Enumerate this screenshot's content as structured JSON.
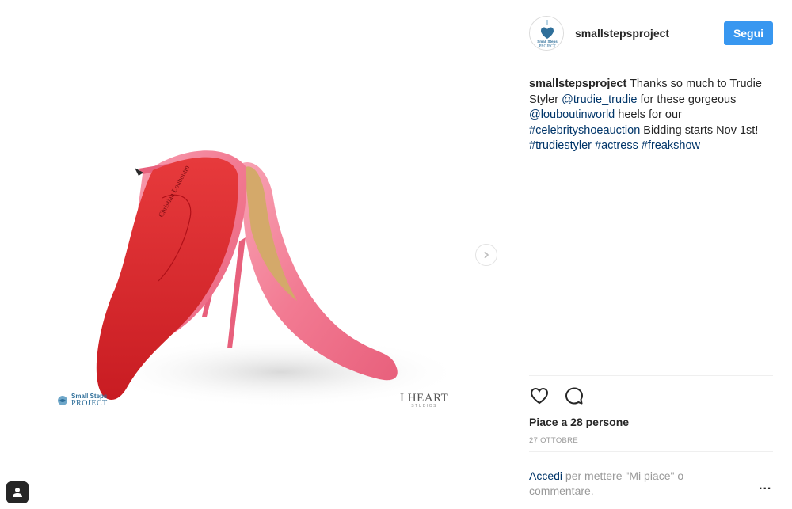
{
  "post": {
    "username": "smallstepsproject",
    "follow_label": "Segui",
    "caption": {
      "author": "smallstepsproject",
      "t1": " Thanks so much to Trudie Styler ",
      "mention1": "@trudie_trudie",
      "t2": " for these gorgeous ",
      "mention2": "@louboutinworld",
      "t3": " heels for our ",
      "hashtag1": "#celebrityshoeauction",
      "t4": " Bidding starts Nov 1st!",
      "hashtag2": "#trudiestyler",
      "hashtag3": "#actress",
      "hashtag4": "#freakshow"
    },
    "likes": "Piace a 28 persone",
    "date": "27 OTTOBRE",
    "login_link": "Accedi",
    "login_rest": " per mettere \"Mi piace\" o commentare.",
    "more": "..."
  },
  "media": {
    "watermark_left_line1": "Small Steps",
    "watermark_left_line2": "PROJECT",
    "watermark_right_line1": "I HEART",
    "watermark_right_line2": "STUDIOS"
  },
  "avatar": {
    "line1": "Small Steps",
    "line2": "PROJECT"
  },
  "colors": {
    "accent": "#3897f0",
    "link": "#003569",
    "shoe_pink": "#f27a92",
    "sole_red": "#d8212a"
  }
}
